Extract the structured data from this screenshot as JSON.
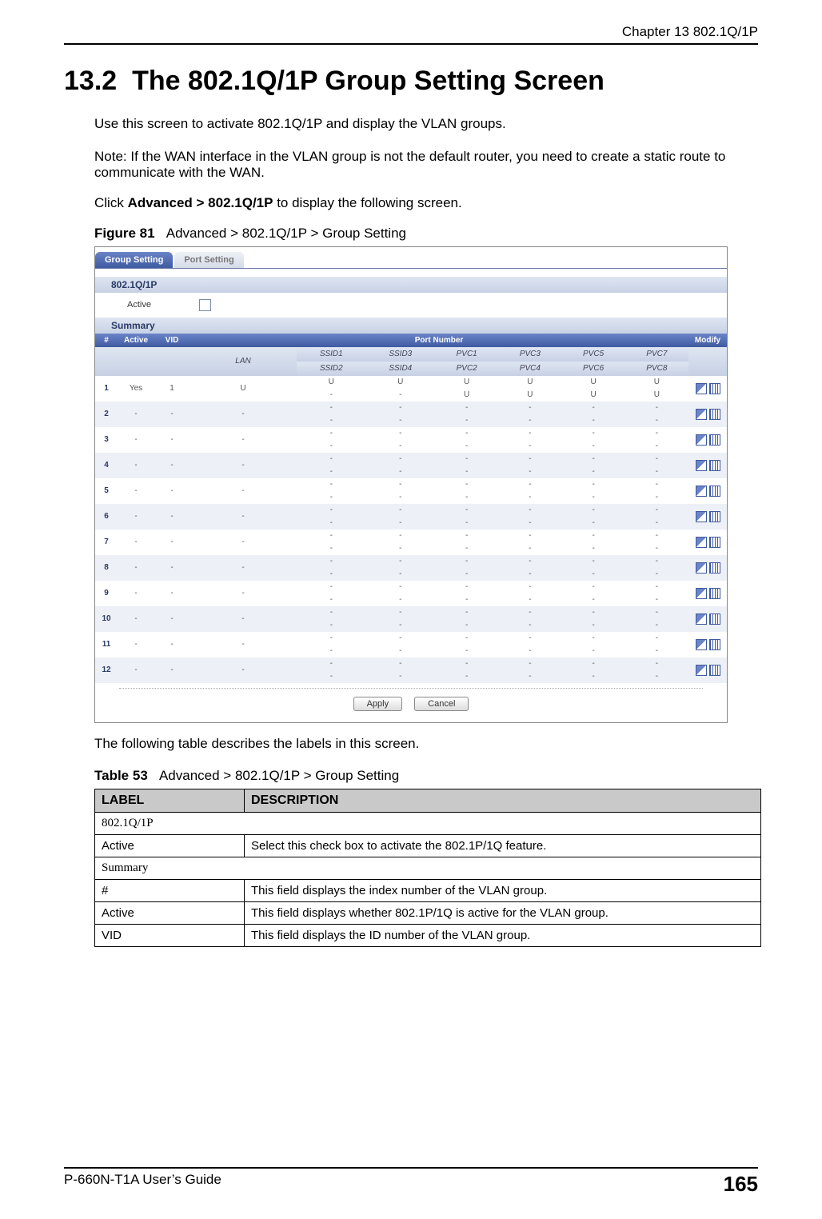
{
  "header": {
    "chapter": "Chapter 13 802.1Q/1P"
  },
  "section": {
    "number": "13.2",
    "title": "The 802.1Q/1P Group Setting Screen",
    "intro": "Use this screen to activate 802.1Q/1P and display the VLAN groups.",
    "note": "Note: If the WAN interface in the VLAN group is not the default router, you need to create a static route to communicate with the WAN.",
    "click_pre": "Click ",
    "click_bold": "Advanced > 802.1Q/1P",
    "click_post": " to display the following screen."
  },
  "figure": {
    "label": "Figure 81",
    "caption": "Advanced > 802.1Q/1P > Group Setting"
  },
  "screenshot": {
    "tabs": {
      "active": "Group Setting",
      "inactive": "Port Setting"
    },
    "band1": "802.1Q/1P",
    "active_label": "Active",
    "band2": "Summary",
    "headers": {
      "num": "#",
      "active": "Active",
      "vid": "VID",
      "portnum": "Port Number",
      "lan": "LAN",
      "ssid1": "SSID1",
      "ssid2": "SSID2",
      "ssid3": "SSID3",
      "ssid4": "SSID4",
      "pvc1": "PVC1",
      "pvc2": "PVC2",
      "pvc3": "PVC3",
      "pvc4": "PVC4",
      "pvc5": "PVC5",
      "pvc6": "PVC6",
      "pvc7": "PVC7",
      "pvc8": "PVC8",
      "modify": "Modify"
    },
    "rows": [
      {
        "n": "1",
        "active": "Yes",
        "vid": "1",
        "lan": "U",
        "r1": [
          "U",
          "-",
          "U",
          "-",
          "U",
          "U",
          "U",
          "U",
          "U",
          "U",
          "U",
          "U"
        ]
      },
      {
        "n": "2",
        "active": "-",
        "vid": "-",
        "lan": "-",
        "r1": [
          "-",
          "-",
          "-",
          "-",
          "-",
          "-",
          "-",
          "-",
          "-",
          "-",
          "-",
          "-"
        ]
      },
      {
        "n": "3",
        "active": "-",
        "vid": "-",
        "lan": "-",
        "r1": [
          "-",
          "-",
          "-",
          "-",
          "-",
          "-",
          "-",
          "-",
          "-",
          "-",
          "-",
          "-"
        ]
      },
      {
        "n": "4",
        "active": "-",
        "vid": "-",
        "lan": "-",
        "r1": [
          "-",
          "-",
          "-",
          "-",
          "-",
          "-",
          "-",
          "-",
          "-",
          "-",
          "-",
          "-"
        ]
      },
      {
        "n": "5",
        "active": "-",
        "vid": "-",
        "lan": "-",
        "r1": [
          "-",
          "-",
          "-",
          "-",
          "-",
          "-",
          "-",
          "-",
          "-",
          "-",
          "-",
          "-"
        ]
      },
      {
        "n": "6",
        "active": "-",
        "vid": "-",
        "lan": "-",
        "r1": [
          "-",
          "-",
          "-",
          "-",
          "-",
          "-",
          "-",
          "-",
          "-",
          "-",
          "-",
          "-"
        ]
      },
      {
        "n": "7",
        "active": "-",
        "vid": "-",
        "lan": "-",
        "r1": [
          "-",
          "-",
          "-",
          "-",
          "-",
          "-",
          "-",
          "-",
          "-",
          "-",
          "-",
          "-"
        ]
      },
      {
        "n": "8",
        "active": "-",
        "vid": "-",
        "lan": "-",
        "r1": [
          "-",
          "-",
          "-",
          "-",
          "-",
          "-",
          "-",
          "-",
          "-",
          "-",
          "-",
          "-"
        ]
      },
      {
        "n": "9",
        "active": "-",
        "vid": "-",
        "lan": "-",
        "r1": [
          "-",
          "-",
          "-",
          "-",
          "-",
          "-",
          "-",
          "-",
          "-",
          "-",
          "-",
          "-"
        ]
      },
      {
        "n": "10",
        "active": "-",
        "vid": "-",
        "lan": "-",
        "r1": [
          "-",
          "-",
          "-",
          "-",
          "-",
          "-",
          "-",
          "-",
          "-",
          "-",
          "-",
          "-"
        ]
      },
      {
        "n": "11",
        "active": "-",
        "vid": "-",
        "lan": "-",
        "r1": [
          "-",
          "-",
          "-",
          "-",
          "-",
          "-",
          "-",
          "-",
          "-",
          "-",
          "-",
          "-"
        ]
      },
      {
        "n": "12",
        "active": "-",
        "vid": "-",
        "lan": "-",
        "r1": [
          "-",
          "-",
          "-",
          "-",
          "-",
          "-",
          "-",
          "-",
          "-",
          "-",
          "-",
          "-"
        ]
      }
    ],
    "apply": "Apply",
    "cancel": "Cancel"
  },
  "table_intro": "The following table describes the labels in this screen.",
  "table": {
    "label": "Table 53",
    "caption": "Advanced > 802.1Q/1P > Group Setting",
    "h_label": "LABEL",
    "h_desc": "DESCRIPTION",
    "rows": [
      {
        "label": "802.1Q/1P",
        "desc": ""
      },
      {
        "label": "Active",
        "desc": "Select this check box to activate the 802.1P/1Q feature."
      },
      {
        "label": "Summary",
        "desc": ""
      },
      {
        "label": "#",
        "desc": "This field displays the index number of the VLAN group."
      },
      {
        "label": "Active",
        "desc": "This field displays whether 802.1P/1Q is active for the VLAN group."
      },
      {
        "label": "VID",
        "desc": "This field displays the ID number of the VLAN group."
      }
    ]
  },
  "footer": {
    "guide": "P-660N-T1A User’s Guide",
    "page": "165"
  }
}
